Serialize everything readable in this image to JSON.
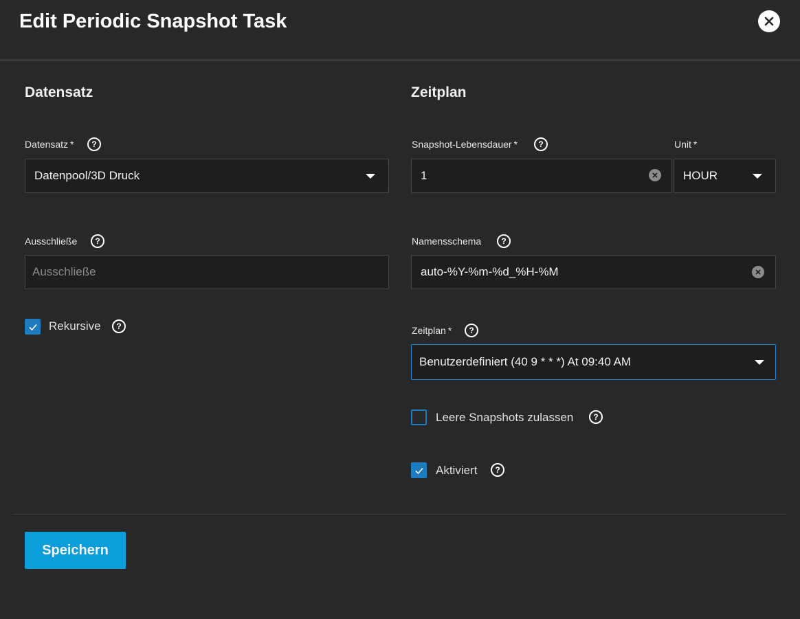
{
  "dialog": {
    "title": "Edit Periodic Snapshot Task"
  },
  "sections": {
    "dataset_title": "Datensatz",
    "schedule_title": "Zeitplan"
  },
  "dataset": {
    "label": "Datensatz",
    "required_mark": "*",
    "value": "Datenpool/3D Druck"
  },
  "exclude": {
    "label": "Ausschließe",
    "placeholder": "Ausschließe",
    "value": ""
  },
  "recursive": {
    "label": "Rekursive",
    "checked": true
  },
  "lifetime": {
    "label": "Snapshot-Lebensdauer",
    "required_mark": "*",
    "value": "1"
  },
  "unit": {
    "label": "Unit",
    "required_mark": "*",
    "value": "HOUR"
  },
  "naming_schema": {
    "label": "Namensschema",
    "value": "auto-%Y-%m-%d_%H-%M"
  },
  "schedule": {
    "label": "Zeitplan",
    "required_mark": "*",
    "value": "Benutzerdefiniert (40 9 * * *) At 09:40 AM"
  },
  "allow_empty": {
    "label": "Leere Snapshots zulassen",
    "checked": false
  },
  "enabled": {
    "label": "Aktiviert",
    "checked": true
  },
  "actions": {
    "save_label": "Speichern"
  },
  "icons": {
    "help": "?",
    "close": "close-icon",
    "check": "check-icon",
    "clear": "clear-icon",
    "dropdown": "chevron-down-icon"
  },
  "colors": {
    "background": "#282828",
    "field_background": "#1e1e1e",
    "accent": "#1d7cbf",
    "primary_button": "#0c9ddb"
  }
}
